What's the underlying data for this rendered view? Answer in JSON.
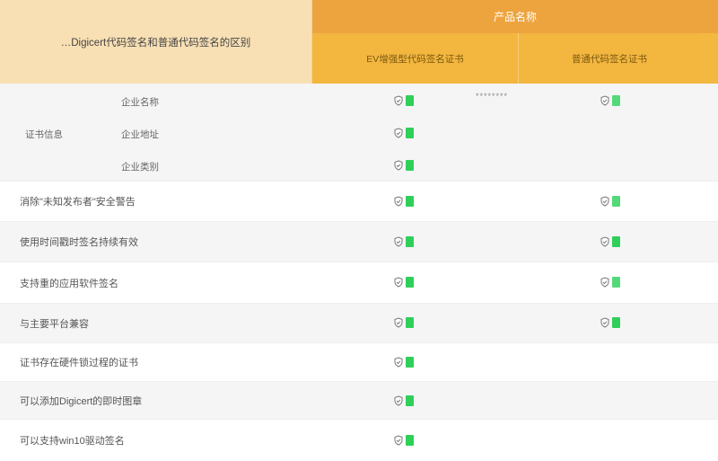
{
  "header": {
    "left_title": "…Digicert代码签名和普通代码签名的区别",
    "product_label": "产品名称",
    "col1": "EV增强型代码签名证书",
    "col2": "普通代码签名证书"
  },
  "cert_info": {
    "group_label": "证书信息",
    "items": [
      "企业名称",
      "企业地址",
      "企业类别"
    ],
    "stars": "********"
  },
  "rows": [
    {
      "label": "消除\"未知发布者\"安全警告"
    },
    {
      "label": "使用时间戳时签名持续有效"
    },
    {
      "label": "支持重的应用软件签名"
    },
    {
      "label": "与主要平台兼容"
    },
    {
      "label": "证书存在硬件锁过程的证书"
    },
    {
      "label": "可以添加Digicert的即时图章"
    },
    {
      "label": "可以支持win10驱动签名"
    }
  ],
  "icons": {
    "check": "shield-check-icon",
    "accent": "#2fcf5a"
  }
}
